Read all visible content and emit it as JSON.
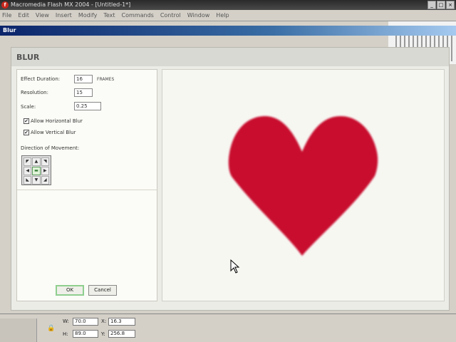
{
  "app": {
    "title": "Macromedia Flash MX 2004 - [Untitled-1*]",
    "logo_letter": "f",
    "window_buttons": [
      "_",
      "□",
      "×"
    ]
  },
  "menu": [
    "File",
    "Edit",
    "View",
    "Insert",
    "Modify",
    "Text",
    "Commands",
    "Control",
    "Window",
    "Help"
  ],
  "dialog_window_title": "Blur",
  "dialog": {
    "heading": "BLUR",
    "effect_duration_label": "Effect Duration:",
    "effect_duration_value": "16",
    "effect_duration_unit": "FRAMES",
    "resolution_label": "Resolution:",
    "resolution_value": "15",
    "scale_label": "Scale:",
    "scale_value": "0.25",
    "allow_horizontal_label": "Allow Horizontal Blur",
    "allow_horizontal_checked": true,
    "allow_vertical_label": "Allow Vertical Blur",
    "allow_vertical_checked": true,
    "direction_label": "Direction of Movement:",
    "direction_arrows": [
      "◤",
      "▲",
      "◥",
      "◀",
      "▬",
      "▶",
      "◣",
      "▼",
      "◢"
    ],
    "check_mark": "✔",
    "ok_label": "OK",
    "cancel_label": "Cancel"
  },
  "preview": {
    "shape_icon": "heart",
    "shape_color": "#c8102e",
    "cursor_icon": "arrow-cursor"
  },
  "properties": {
    "w_label": "W:",
    "w_value": "70.0",
    "h_label": "H:",
    "h_value": "89.0",
    "x_label": "X:",
    "x_value": "16.3",
    "y_label": "Y:",
    "y_value": "256.8",
    "lock_icon": "lock"
  }
}
